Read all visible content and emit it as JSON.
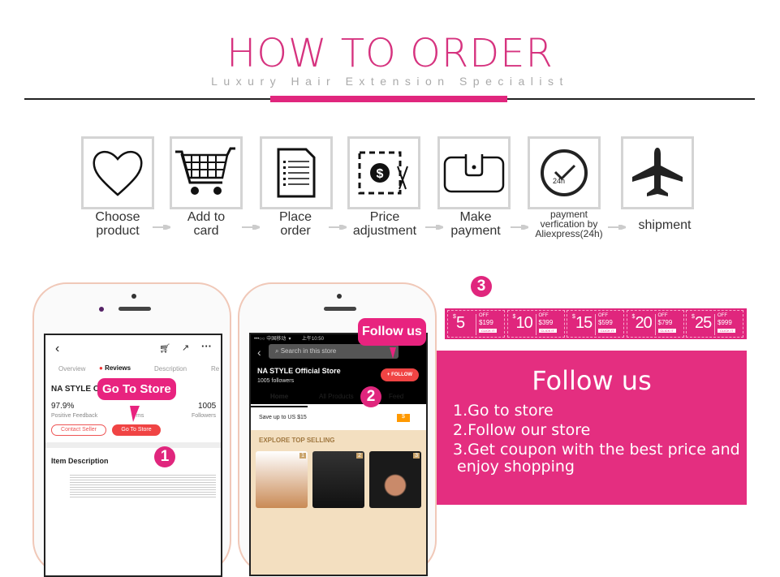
{
  "header": {
    "title": "HOW TO ORDER",
    "subtitle": "Luxury Hair Extension Specialist"
  },
  "colors": {
    "accent": "#e0267d",
    "panel": "#e42e80",
    "button_red": "#f04444"
  },
  "steps": [
    {
      "icon": "heart-icon",
      "line1": "Choose",
      "line2": "product"
    },
    {
      "icon": "shopping-cart-icon",
      "line1": "Add to",
      "line2": "card"
    },
    {
      "icon": "document-icon",
      "line1": "Place",
      "line2": "order"
    },
    {
      "icon": "coupon-scissors-icon",
      "line1": "Price",
      "line2": "adjustment"
    },
    {
      "icon": "wallet-icon",
      "line1": "Make",
      "line2": "payment"
    },
    {
      "icon": "clock-check-icon",
      "line1": "payment",
      "line2": "verfication by",
      "line3": "Aliexpress(24h)",
      "icon_text": "24h"
    },
    {
      "icon": "airplane-icon",
      "line1": "shipment"
    }
  ],
  "phone1": {
    "tabs": [
      "Overview",
      "Reviews",
      "Description",
      "Re"
    ],
    "store": "NA STYLE Of",
    "feedback_value": "97.9%",
    "feedback_label": "Positive Feedback",
    "items_label": "ms",
    "followers_value": "1005",
    "followers_label": "Followers",
    "contact_button": "Contact Seller",
    "store_button": "Go To Store",
    "bubble": "Go To Store",
    "step": "1",
    "section": "Item Description"
  },
  "phone2": {
    "status": "•••○○ 中国移动  ▾        上午10:50",
    "search_placeholder": "Search in this store",
    "store": "NA STYLE Official Store",
    "followers": "1005  followers",
    "follow_button": "+ FOLLOW",
    "bubble": "Follow us",
    "tabs": [
      "Home",
      "All Products",
      "Feed"
    ],
    "step": "2",
    "save": "Save up to US $15",
    "explore": "EXPLORE TOP SELLING",
    "ranks": [
      "1",
      "2",
      "3"
    ]
  },
  "coupons_step": "3",
  "coupons": [
    {
      "amount": "5",
      "min": "$199"
    },
    {
      "amount": "10",
      "min": "$399"
    },
    {
      "amount": "15",
      "min": "$599"
    },
    {
      "amount": "20",
      "min": "$799"
    },
    {
      "amount": "25",
      "min": "$999"
    }
  ],
  "coupon_labels": {
    "currency": "$",
    "off": "OFF",
    "click": "CLICK IT"
  },
  "panel": {
    "title": "Follow us",
    "items": [
      "1.Go to store",
      "2.Follow our store",
      "3.Get coupon with the best price and",
      "enjoy shopping"
    ]
  }
}
